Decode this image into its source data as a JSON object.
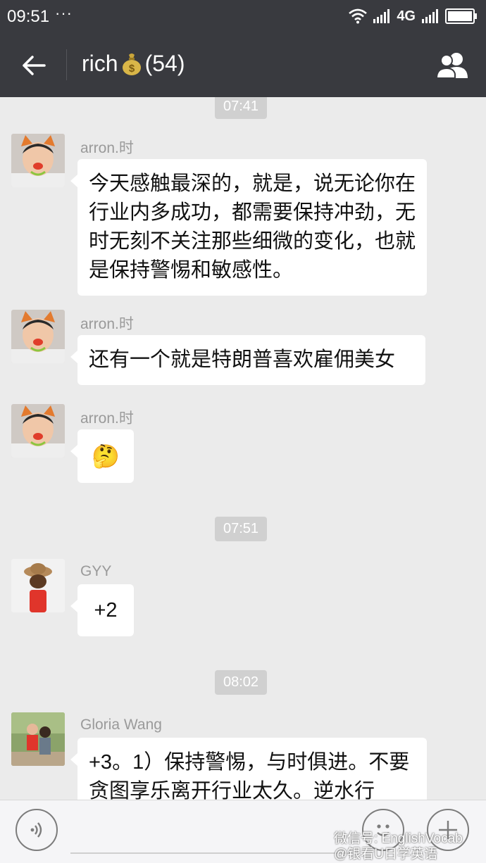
{
  "status_bar": {
    "time": "09:51",
    "dots": "···",
    "network": "4G"
  },
  "header": {
    "title": "rich",
    "count": "(54)"
  },
  "chat": {
    "timestamps": [
      "07:41",
      "07:51",
      "08:02"
    ],
    "messages": [
      {
        "sender": "arron.时",
        "text": "今天感触最深的，就是，说无论你在行业内多成功，都需要保持冲劲，无时无刻不关注那些细微的变化，也就是保持警惕和敏感性。"
      },
      {
        "sender": "arron.时",
        "text": "还有一个就是特朗普喜欢雇佣美女"
      },
      {
        "sender": "arron.时",
        "emoji": "🤔"
      },
      {
        "sender": "GYY",
        "text": "+2"
      },
      {
        "sender": "Gloria Wang",
        "text": "+3。1）保持警惕，与时俱进。不要贪图享乐离开行业太久。逆水行"
      }
    ]
  },
  "watermark": {
    "line1": "微信号: EnglishVocab",
    "line2": "@银看U日学英语"
  }
}
